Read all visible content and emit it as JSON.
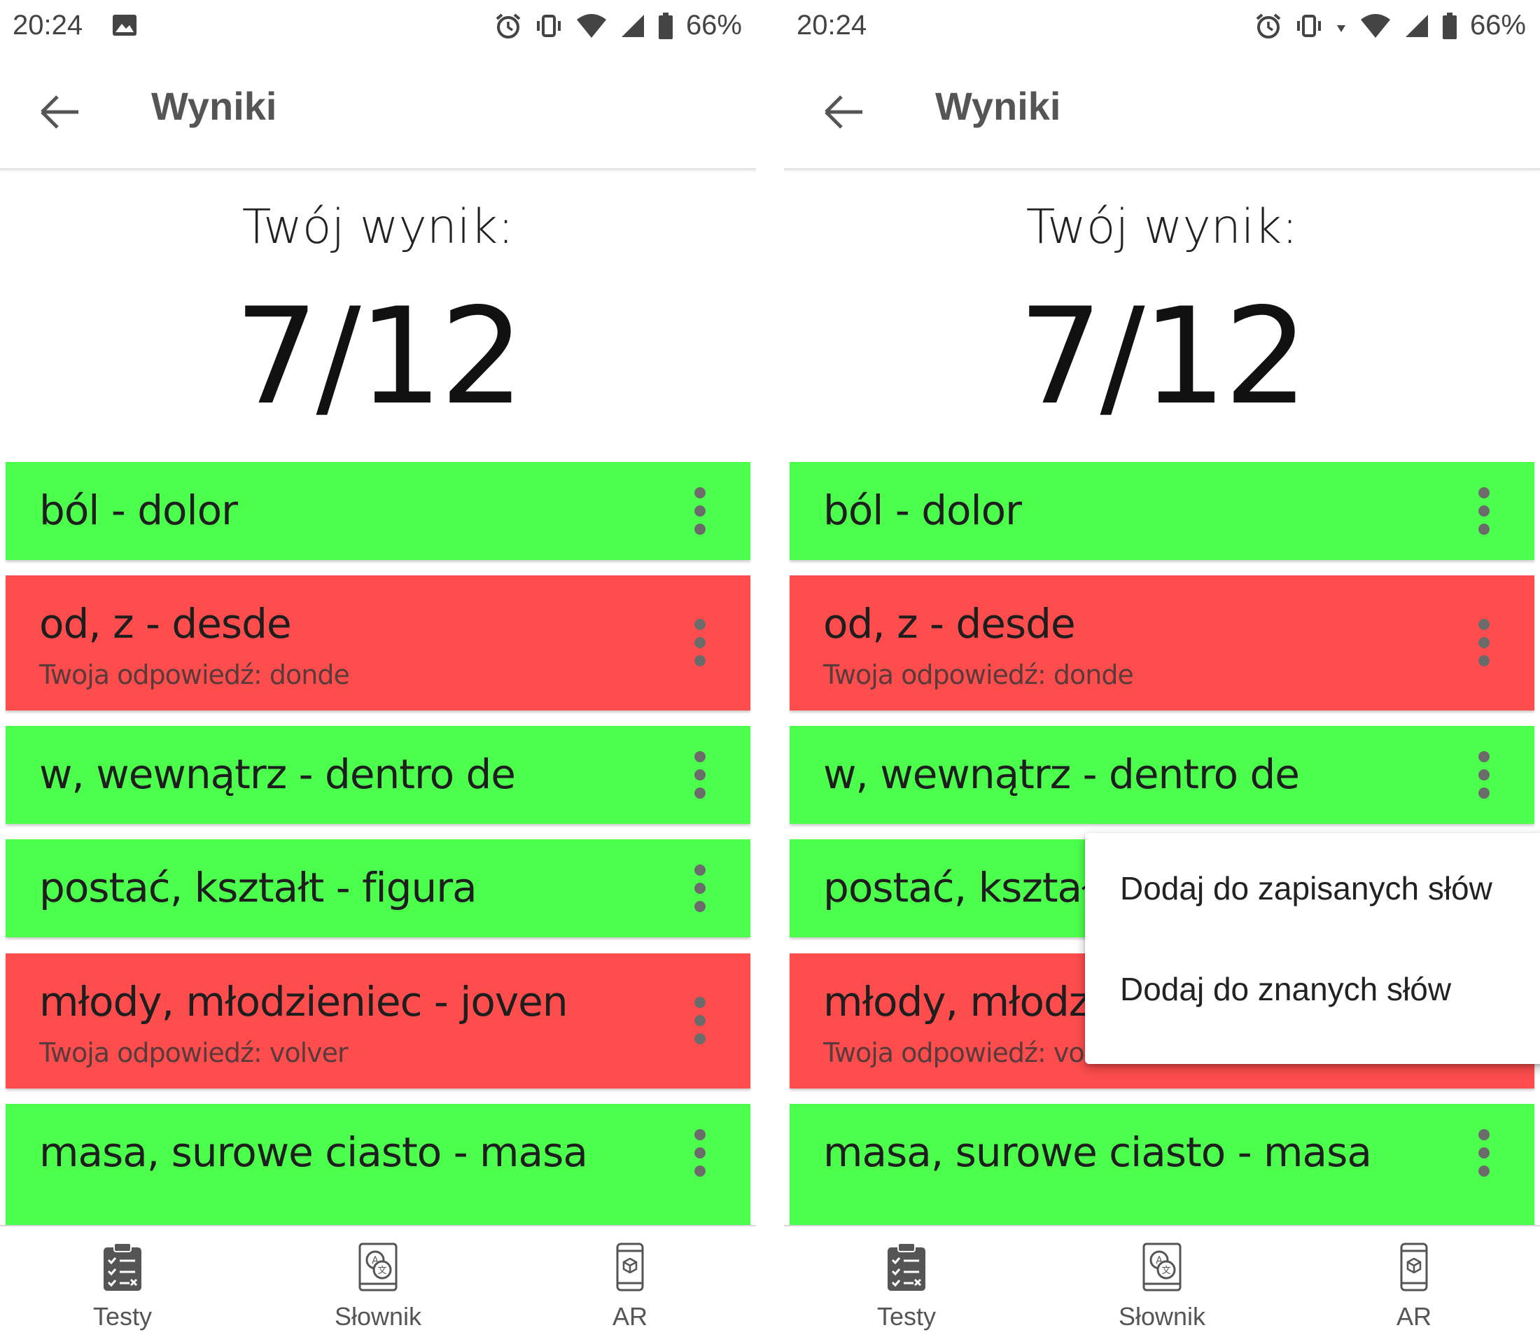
{
  "status_bar": {
    "time": "20:24",
    "battery": "66%"
  },
  "app_bar": {
    "title": "Wyniki"
  },
  "score": {
    "label": "Twój wynik:",
    "value": "7/12"
  },
  "results": [
    {
      "text": "ból - dolor",
      "correct": true,
      "answer": ""
    },
    {
      "text": "od, z - desde",
      "correct": false,
      "answer": "Twoja odpowiedź: donde"
    },
    {
      "text": "w, wewnątrz - dentro de",
      "correct": true,
      "answer": ""
    },
    {
      "text": "postać, kształt - figura",
      "correct": true,
      "answer": ""
    },
    {
      "text": "młody, młodzieniec - joven",
      "correct": false,
      "answer": "Twoja odpowiedź: volver"
    },
    {
      "text": "masa, surowe ciasto - masa",
      "correct": true,
      "answer": ""
    }
  ],
  "popup_menu": {
    "items": [
      "Dodaj do zapisanych słów",
      "Dodaj do znanych słów"
    ]
  },
  "bottom_nav": {
    "items": [
      {
        "label": "Testy",
        "icon": "clipboard-checklist-icon"
      },
      {
        "label": "Słownik",
        "icon": "translate-book-icon"
      },
      {
        "label": "AR",
        "icon": "ar-phone-icon"
      }
    ]
  },
  "colors": {
    "correct": "#4dff4d",
    "incorrect": "#ff4d4d"
  }
}
